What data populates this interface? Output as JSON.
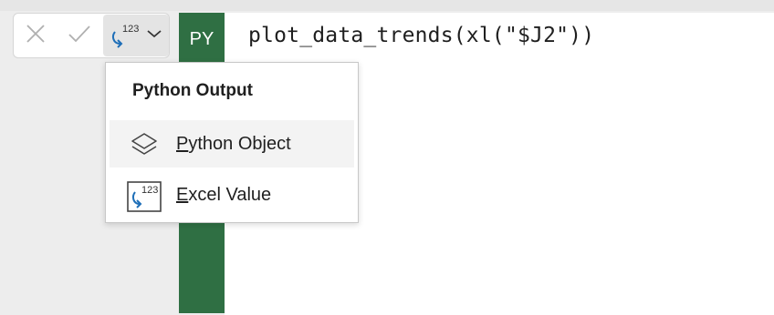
{
  "formula_bar": {
    "cancel_icon": "close-icon",
    "enter_icon": "checkmark-icon",
    "output_icon": "python-excel-value-icon",
    "output_icon_text": "123",
    "dropdown_icon": "chevron-down-icon",
    "py_badge": "PY",
    "formula": "plot_data_trends(xl(\"$J2\"))"
  },
  "menu": {
    "header": "Python Output",
    "items": [
      {
        "icon": "layers-icon",
        "first": "P",
        "rest": "ython Object"
      },
      {
        "icon": "excel-value-icon",
        "icon_text": "123",
        "first": "E",
        "rest": "xcel Value"
      }
    ]
  },
  "colors": {
    "py_green": "#2f6f43",
    "hover_bg": "#f3f3f3",
    "icon_blue": "#1e6fb8"
  }
}
